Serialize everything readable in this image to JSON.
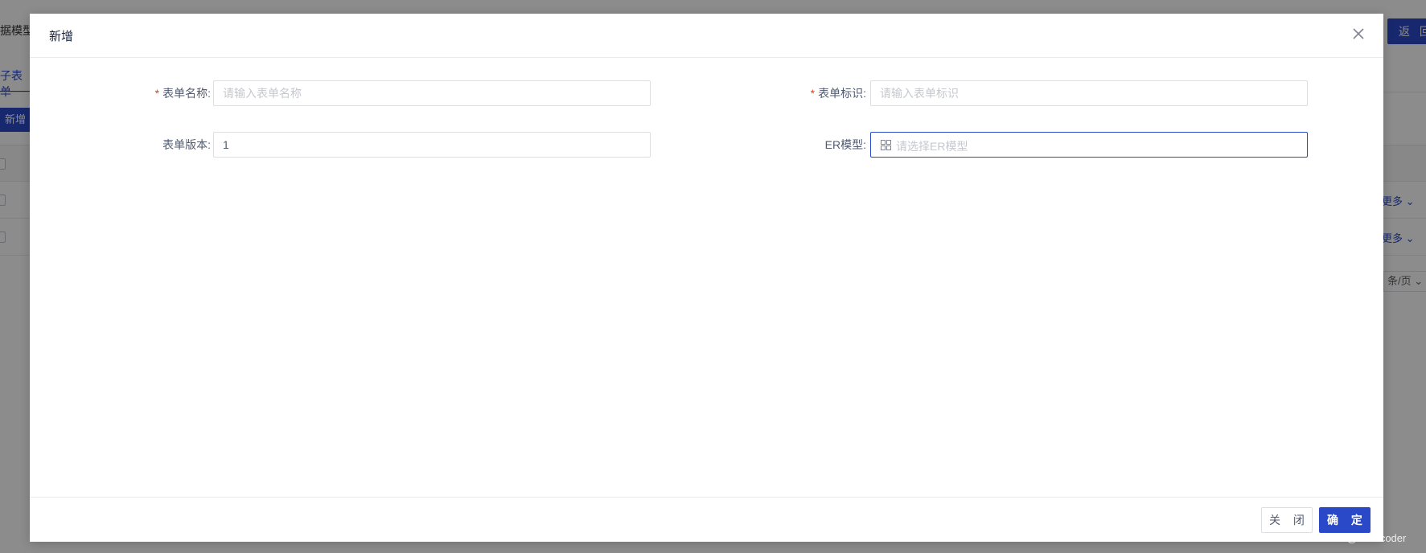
{
  "background": {
    "breadcrumb": "据模型",
    "back_button": "返 回",
    "tab_label": "子表单",
    "add_button": "新增",
    "row_more_label": "更多",
    "pager_label": "条/页"
  },
  "dialog": {
    "title": "新增",
    "fields": {
      "form_name": {
        "label": "表单名称:",
        "required": "*",
        "placeholder": "请输入表单名称",
        "value": ""
      },
      "form_id": {
        "label": "表单标识:",
        "required": "*",
        "placeholder": "请输入表单标识",
        "value": ""
      },
      "form_version": {
        "label": "表单版本:",
        "value": "1"
      },
      "er_model": {
        "label": "ER模型:",
        "placeholder": "请选择ER模型",
        "icon": "grid-icon"
      }
    },
    "footer": {
      "close_label": "关 闭",
      "ok_label": "确 定"
    }
  },
  "watermark": "CSDN @web-coder",
  "colors": {
    "primary": "#2a49c8",
    "required": "#ed4014",
    "mask": "rgba(0,0,0,0.45)"
  }
}
